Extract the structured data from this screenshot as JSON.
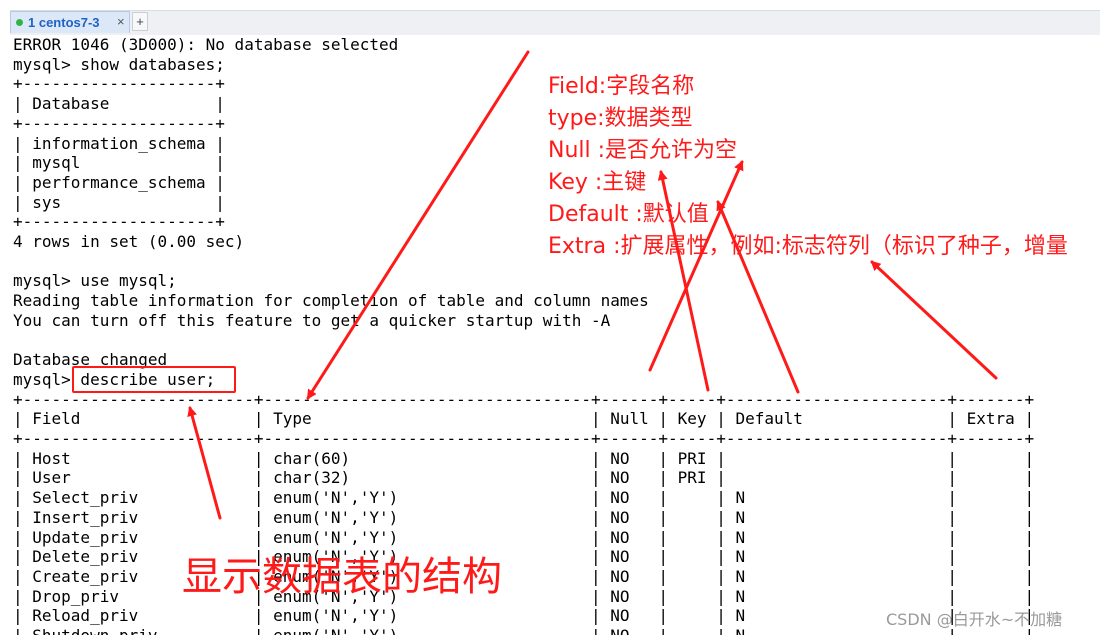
{
  "tab": {
    "title": "1 centos7-3",
    "close": "×",
    "add": "+"
  },
  "terminal": {
    "lines": [
      "ERROR 1046 (3D000): No database selected",
      "mysql> show databases;",
      "+--------------------+",
      "| Database           |",
      "+--------------------+",
      "| information_schema |",
      "| mysql              |",
      "| performance_schema |",
      "| sys                |",
      "+--------------------+",
      "4 rows in set (0.00 sec)",
      "",
      "mysql> use mysql;",
      "Reading table information for completion of table and column names",
      "You can turn off this feature to get a quicker startup with -A",
      "",
      "Database changed",
      "mysql> describe user;",
      "+------------------------+----------------------------------+------+-----+-----------------------+-------+",
      "| Field                  | Type                             | Null | Key | Default               | Extra |",
      "+------------------------+----------------------------------+------+-----+-----------------------+-------+",
      "| Host                   | char(60)                         | NO   | PRI |                       |       |",
      "| User                   | char(32)                         | NO   | PRI |                       |       |",
      "| Select_priv            | enum('N','Y')                    | NO   |     | N                     |       |",
      "| Insert_priv            | enum('N','Y')                    | NO   |     | N                     |       |",
      "| Update_priv            | enum('N','Y')                    | NO   |     | N                     |       |",
      "| Delete_priv            | enum('N','Y')                    | NO   |     | N                     |       |",
      "| Create_priv            | enum('N','Y')                    | NO   |     | N                     |       |",
      "| Drop_priv              | enum('N','Y')                    | NO   |     | N                     |       |",
      "| Reload_priv            | enum('N','Y')                    | NO   |     | N                     |       |",
      "| Shutdown_priv          | enum('N','Y')                    | NO   |     | N                     |       |"
    ]
  },
  "annotations": {
    "fields": [
      "Field:字段名称",
      "type:数据类型",
      "Null :是否允许为空",
      "Key :主键",
      "Default :默认值",
      "Extra :扩展属性，例如:标志符列（标识了种子，增量"
    ],
    "caption": "显示数据表的结构",
    "accent_color": "#ff1a1a"
  },
  "watermark": "CSDN @白开水~不加糖"
}
